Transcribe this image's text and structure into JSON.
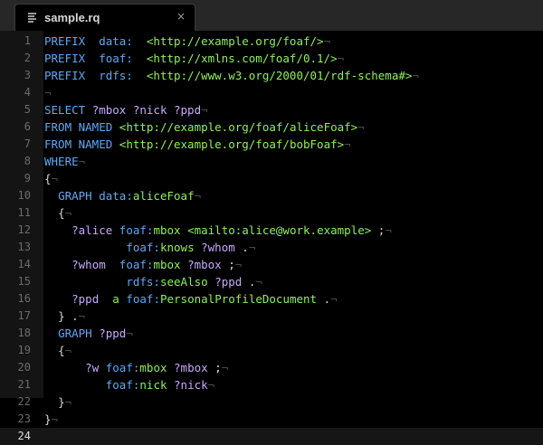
{
  "tab": {
    "title": "sample.rq",
    "icon": "file-icon",
    "close_glyph": "×"
  },
  "current_line": 24,
  "colors": {
    "keyword": "#5fa8f5",
    "uri": "#8ff05a",
    "variable": "#c9a8ff",
    "background": "#000000"
  },
  "lines": [
    {
      "n": "1",
      "tokens": [
        {
          "t": "PREFIX",
          "c": "kw"
        },
        {
          "t": "  data:  ",
          "c": "kw"
        },
        {
          "t": "<http://example.org/foaf/>",
          "c": "uri"
        },
        {
          "t": "¬",
          "c": "ws"
        }
      ]
    },
    {
      "n": "2",
      "tokens": [
        {
          "t": "PREFIX",
          "c": "kw"
        },
        {
          "t": "  foaf:  ",
          "c": "kw"
        },
        {
          "t": "<http://xmlns.com/foaf/0.1/>",
          "c": "uri"
        },
        {
          "t": "¬",
          "c": "ws"
        }
      ]
    },
    {
      "n": "3",
      "tokens": [
        {
          "t": "PREFIX",
          "c": "kw"
        },
        {
          "t": "  rdfs:  ",
          "c": "kw"
        },
        {
          "t": "<http://www.w3.org/2000/01/rdf-schema#>",
          "c": "uri"
        },
        {
          "t": "¬",
          "c": "ws"
        }
      ]
    },
    {
      "n": "4",
      "tokens": [
        {
          "t": "¬",
          "c": "ws"
        }
      ]
    },
    {
      "n": "5",
      "tokens": [
        {
          "t": "SELECT ",
          "c": "kw"
        },
        {
          "t": "?mbox ?nick ?ppd",
          "c": "var"
        },
        {
          "t": "¬",
          "c": "ws"
        }
      ]
    },
    {
      "n": "6",
      "tokens": [
        {
          "t": "FROM NAMED ",
          "c": "kw"
        },
        {
          "t": "<http://example.org/foaf/aliceFoaf>",
          "c": "uri"
        },
        {
          "t": "¬",
          "c": "ws"
        }
      ]
    },
    {
      "n": "7",
      "tokens": [
        {
          "t": "FROM NAMED ",
          "c": "kw"
        },
        {
          "t": "<http://example.org/foaf/bobFoaf>",
          "c": "uri"
        },
        {
          "t": "¬",
          "c": "ws"
        }
      ]
    },
    {
      "n": "8",
      "tokens": [
        {
          "t": "WHERE",
          "c": "kw"
        },
        {
          "t": "¬",
          "c": "ws"
        }
      ]
    },
    {
      "n": "9",
      "tokens": [
        {
          "t": "{",
          "c": "pun"
        },
        {
          "t": "¬",
          "c": "ws"
        }
      ]
    },
    {
      "n": "10",
      "tokens": [
        {
          "t": "  ",
          "c": "ws"
        },
        {
          "t": "GRAPH ",
          "c": "kw"
        },
        {
          "t": "data:",
          "c": "pfx"
        },
        {
          "t": "aliceFoaf",
          "c": "loc"
        },
        {
          "t": "¬",
          "c": "ws"
        }
      ]
    },
    {
      "n": "11",
      "tokens": [
        {
          "t": "  ",
          "c": "ws"
        },
        {
          "t": "{",
          "c": "pun"
        },
        {
          "t": "¬",
          "c": "ws"
        }
      ]
    },
    {
      "n": "12",
      "tokens": [
        {
          "t": "  ",
          "c": "ws"
        },
        {
          "t": "  ?alice ",
          "c": "var"
        },
        {
          "t": "foaf:",
          "c": "pfx"
        },
        {
          "t": "mbox ",
          "c": "loc"
        },
        {
          "t": "<mailto:alice@work.example>",
          "c": "uri"
        },
        {
          "t": " ;",
          "c": "pun"
        },
        {
          "t": "¬",
          "c": "ws"
        }
      ]
    },
    {
      "n": "13",
      "tokens": [
        {
          "t": "  ",
          "c": "ws"
        },
        {
          "t": "          ",
          "c": "ws"
        },
        {
          "t": "foaf:",
          "c": "pfx"
        },
        {
          "t": "knows ",
          "c": "loc"
        },
        {
          "t": "?whom",
          "c": "var"
        },
        {
          "t": " .",
          "c": "pun"
        },
        {
          "t": "¬",
          "c": "ws"
        }
      ]
    },
    {
      "n": "14",
      "tokens": [
        {
          "t": "  ",
          "c": "ws"
        },
        {
          "t": "  ?whom  ",
          "c": "var"
        },
        {
          "t": "foaf:",
          "c": "pfx"
        },
        {
          "t": "mbox ",
          "c": "loc"
        },
        {
          "t": "?mbox",
          "c": "var"
        },
        {
          "t": " ;",
          "c": "pun"
        },
        {
          "t": "¬",
          "c": "ws"
        }
      ]
    },
    {
      "n": "15",
      "tokens": [
        {
          "t": "  ",
          "c": "ws"
        },
        {
          "t": "          ",
          "c": "ws"
        },
        {
          "t": "rdfs:",
          "c": "pfx"
        },
        {
          "t": "seeAlso ",
          "c": "loc"
        },
        {
          "t": "?ppd",
          "c": "var"
        },
        {
          "t": " .",
          "c": "pun"
        },
        {
          "t": "¬",
          "c": "ws"
        }
      ]
    },
    {
      "n": "16",
      "tokens": [
        {
          "t": "  ",
          "c": "ws"
        },
        {
          "t": "  ?ppd  ",
          "c": "var"
        },
        {
          "t": "a ",
          "c": "loc"
        },
        {
          "t": "foaf:",
          "c": "pfx"
        },
        {
          "t": "PersonalProfileDocument",
          "c": "loc"
        },
        {
          "t": " .",
          "c": "pun"
        },
        {
          "t": "¬",
          "c": "ws"
        }
      ]
    },
    {
      "n": "17",
      "tokens": [
        {
          "t": "  ",
          "c": "ws"
        },
        {
          "t": "} .",
          "c": "pun"
        },
        {
          "t": "¬",
          "c": "ws"
        }
      ]
    },
    {
      "n": "18",
      "tokens": [
        {
          "t": "  ",
          "c": "ws"
        },
        {
          "t": "GRAPH ",
          "c": "kw"
        },
        {
          "t": "?ppd",
          "c": "var"
        },
        {
          "t": "¬",
          "c": "ws"
        }
      ]
    },
    {
      "n": "19",
      "tokens": [
        {
          "t": "  ",
          "c": "ws"
        },
        {
          "t": "{",
          "c": "pun"
        },
        {
          "t": "¬",
          "c": "ws"
        }
      ]
    },
    {
      "n": "20",
      "tokens": [
        {
          "t": "  ",
          "c": "ws"
        },
        {
          "t": "    ?w ",
          "c": "var"
        },
        {
          "t": "foaf:",
          "c": "pfx"
        },
        {
          "t": "mbox ",
          "c": "loc"
        },
        {
          "t": "?mbox",
          "c": "var"
        },
        {
          "t": " ;",
          "c": "pun"
        },
        {
          "t": "¬",
          "c": "ws"
        }
      ]
    },
    {
      "n": "21",
      "tokens": [
        {
          "t": "  ",
          "c": "ws"
        },
        {
          "t": "       ",
          "c": "ws"
        },
        {
          "t": "foaf:",
          "c": "pfx"
        },
        {
          "t": "nick ",
          "c": "loc"
        },
        {
          "t": "?nick",
          "c": "var"
        },
        {
          "t": "¬",
          "c": "ws"
        }
      ]
    },
    {
      "n": "22",
      "tokens": [
        {
          "t": "  ",
          "c": "ws"
        },
        {
          "t": "}",
          "c": "pun"
        },
        {
          "t": "¬",
          "c": "ws"
        }
      ]
    },
    {
      "n": "23",
      "tokens": [
        {
          "t": "}",
          "c": "pun"
        },
        {
          "t": "¬",
          "c": "ws"
        }
      ]
    },
    {
      "n": "24",
      "tokens": []
    }
  ]
}
